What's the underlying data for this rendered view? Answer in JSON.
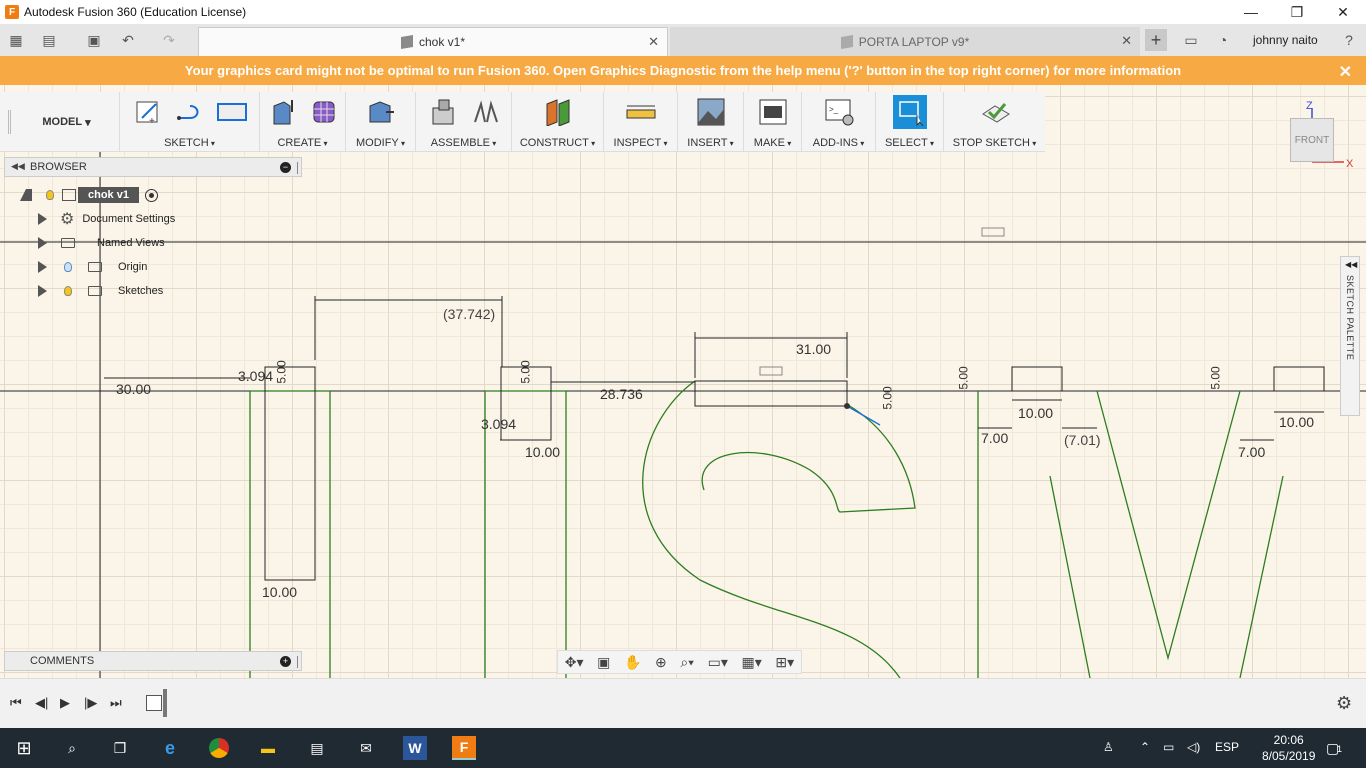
{
  "window": {
    "title": "Autodesk Fusion 360 (Education License)",
    "minimize": "—",
    "restore": "❐",
    "close": "✕"
  },
  "tabs": [
    {
      "label": "chok v1*"
    },
    {
      "label": "PORTA LAPTOP v9*"
    }
  ],
  "tab_close": "✕",
  "user": "johnny naito",
  "banner": {
    "text": "Your graphics card might not be optimal to run Fusion 360. Open Graphics Diagnostic from the help menu ('?' button in the top right corner) for more information",
    "close": "✕"
  },
  "toolbar": {
    "workspace": "MODEL",
    "groups": [
      "SKETCH",
      "CREATE",
      "MODIFY",
      "ASSEMBLE",
      "CONSTRUCT",
      "INSPECT",
      "INSERT",
      "MAKE",
      "ADD-INS",
      "SELECT",
      "STOP SKETCH"
    ]
  },
  "viewcube": {
    "face": "FRONT",
    "axis_z": "Z",
    "axis_x": "X"
  },
  "browser": {
    "title": "BROWSER",
    "root": "chok v1",
    "items": [
      "Document Settings",
      "Named Views",
      "Origin",
      "Sketches"
    ]
  },
  "sketch_palette": "SKETCH PALETTE",
  "comments": {
    "title": "COMMENTS"
  },
  "dimensions": [
    "(37.742)",
    "30.00",
    "3.094",
    "5.00",
    "10.00",
    "5.00",
    "3.094",
    "10.00",
    "28.736",
    "31.00",
    "5.00",
    "5.00",
    "10.00",
    "7.00",
    "(7.01)",
    "5.00",
    "10.00",
    "7.00"
  ],
  "taskbar": {
    "language": "ESP",
    "time": "20:06",
    "date": "8/05/2019",
    "notifications": "1"
  },
  "colors": {
    "banner": "#f7a943",
    "canvas": "#fbf5e9",
    "sketch_line": "#2e7d1f",
    "accent": "#1a8fd8",
    "taskbar": "#1f2a33"
  }
}
